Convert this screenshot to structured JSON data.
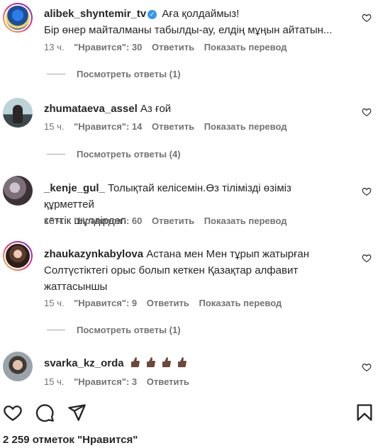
{
  "comments": [
    {
      "username": "alibek_shyntemir_tv",
      "verified": true,
      "text": "Аға қолдаймыз!",
      "text_line2": "Бір өнер майталманы табылды-ау, елдің мұңын айтатын...",
      "time": "13 ч.",
      "likes": "\"Нравится\": 30",
      "reply": "Ответить",
      "translate": "Показать перевод",
      "view_replies": "Посмотреть ответы (1)"
    },
    {
      "username": "zhumataeva_assel",
      "text": "Аз ғой",
      "time": "15 ч.",
      "likes": "\"Нравится\": 14",
      "reply": "Ответить",
      "translate": "Показать перевод",
      "view_replies": "Посмотреть ответы (4)"
    },
    {
      "username": "_kenje_gul_",
      "text": "Толықтай келісемін.Өз тілімізді өзіміз құрметтей",
      "text_line2": "кеттік шүлдірдеп",
      "time": "15 ч.",
      "likes": "\"Нравится\": 60",
      "reply": "Ответить",
      "translate": "Показать перевод"
    },
    {
      "username": "zhaukazynkabylova",
      "text": "Астана мен Мен тұрып жатырған",
      "text_line2": "Солтүстіктегі орыс болып кеткен Қазақтар алфавит",
      "text_line3": "жаттасыншы",
      "time": "15 ч.",
      "likes": "\"Нравится\": 9",
      "reply": "Ответить",
      "translate": "Показать перевод",
      "view_replies": "Посмотреть ответы (1)"
    },
    {
      "username": "svarka_kz_orda",
      "emoji": "thumbs-up-dark-skin x4",
      "time": "15 ч.",
      "likes": "\"Нравится\": 3",
      "reply": "Ответить"
    }
  ],
  "icons": {
    "like": "heart-icon",
    "comment": "comment-icon",
    "share": "send-icon",
    "save": "bookmark-icon"
  },
  "footer": {
    "likes_count": "2 259 отметок \"Нравится\""
  },
  "colors": {
    "text": "#262626",
    "secondary": "#737373",
    "verified": "#3897f0",
    "emoji_skin": "#6b4a3a"
  }
}
